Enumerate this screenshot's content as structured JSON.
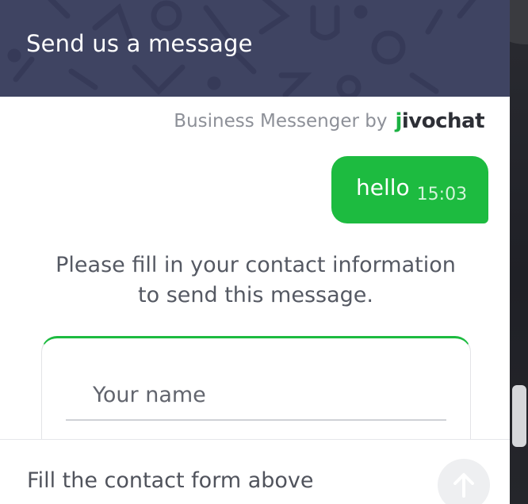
{
  "header": {
    "title": "Send us a message"
  },
  "branding": {
    "text": "Business Messenger by",
    "logo_prefix": "j",
    "logo_rest": "ivochat"
  },
  "messages": [
    {
      "text": "hello",
      "time": "15:03"
    }
  ],
  "prompt": {
    "text": "Please fill in your contact information to send this message."
  },
  "contact_form": {
    "name_placeholder": "Your name",
    "name_value": ""
  },
  "footer": {
    "status_text": "Fill the contact form above",
    "send_icon": "arrow-up-icon"
  },
  "colors": {
    "header": "#3f4462",
    "accent": "#1dbb40",
    "bubble": "#1dbb40",
    "text_muted": "#8d9098"
  }
}
